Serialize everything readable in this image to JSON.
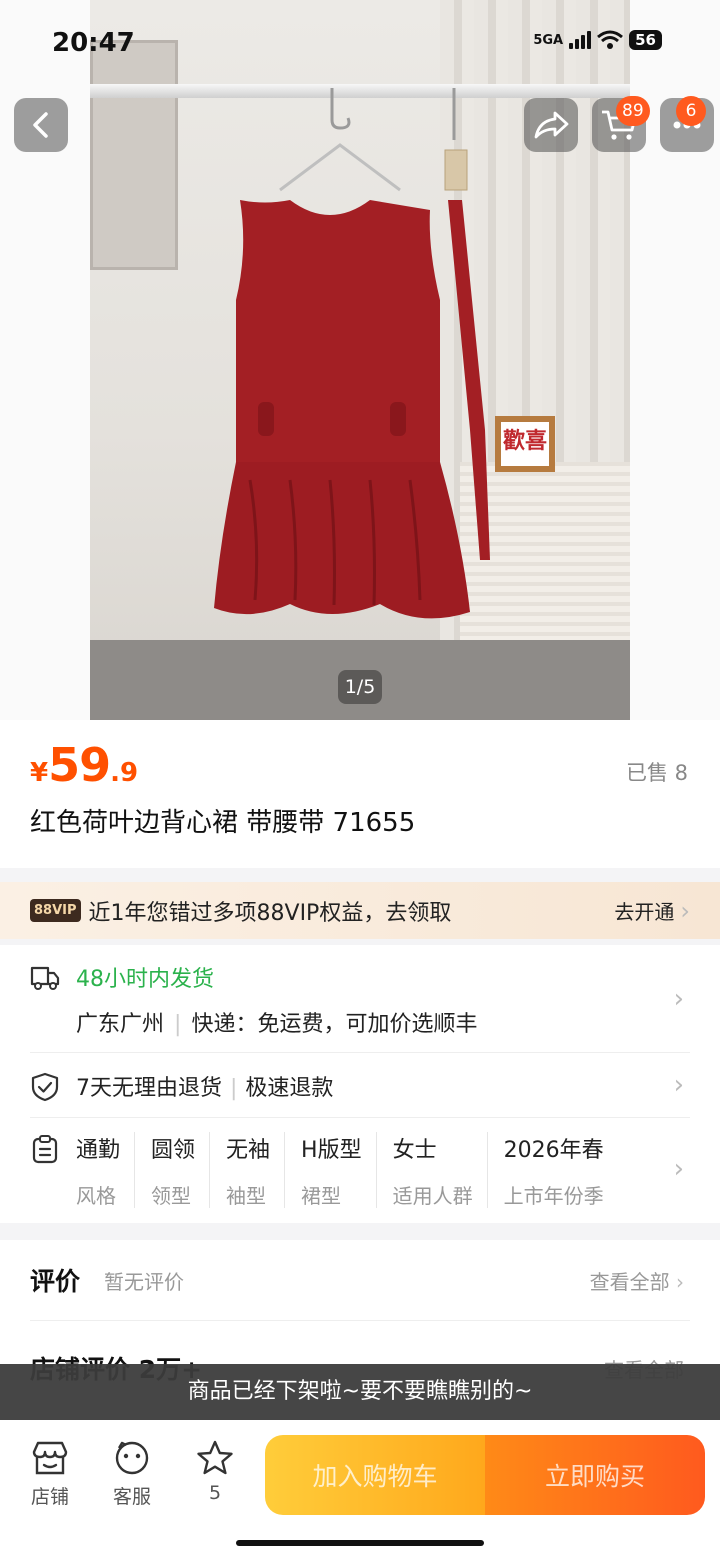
{
  "status_bar": {
    "time": "20:47",
    "network": "5GA",
    "battery": "56"
  },
  "nav": {
    "cart_badge": "89",
    "more_badge": "6"
  },
  "hero": {
    "frame_text": "歡喜",
    "image_counter": "1/5"
  },
  "product": {
    "currency": "¥",
    "price_int": "59",
    "price_dec": ".9",
    "sold": "已售 8",
    "title": "红色荷叶边背心裙 带腰带 71655"
  },
  "vip": {
    "tag": "88VIP",
    "text": "近1年您错过多项88VIP权益，去领取",
    "action": "去开通"
  },
  "shipping": {
    "speed": "48小时内发货",
    "location": "广东广州",
    "delivery": "快递：免运费，可加价选顺丰"
  },
  "returns": {
    "policy": "7天无理由退货",
    "refund": "极速退款"
  },
  "attributes": [
    {
      "value": "通勤",
      "key": "风格"
    },
    {
      "value": "圆领",
      "key": "领型"
    },
    {
      "value": "无袖",
      "key": "袖型"
    },
    {
      "value": "H版型",
      "key": "裙型"
    },
    {
      "value": "女士",
      "key": "适用人群"
    },
    {
      "value": "2026年春",
      "key": "上市年份季"
    }
  ],
  "reviews": {
    "title": "评价",
    "subtitle": "暂无评价",
    "view_all": "查看全部"
  },
  "store_reviews": {
    "title": "店铺评价 2万+",
    "view_all": "查看全部"
  },
  "toast": "商品已经下架啦~要不要瞧瞧别的~",
  "bottom_bar": {
    "store_label": "店铺",
    "service_label": "客服",
    "fav_count": "5",
    "add_cart": "加入购物车",
    "buy_now": "立即购买"
  },
  "colors": {
    "accent": "#ff5000",
    "green": "#2bb24c",
    "dress": "#a31f24"
  }
}
